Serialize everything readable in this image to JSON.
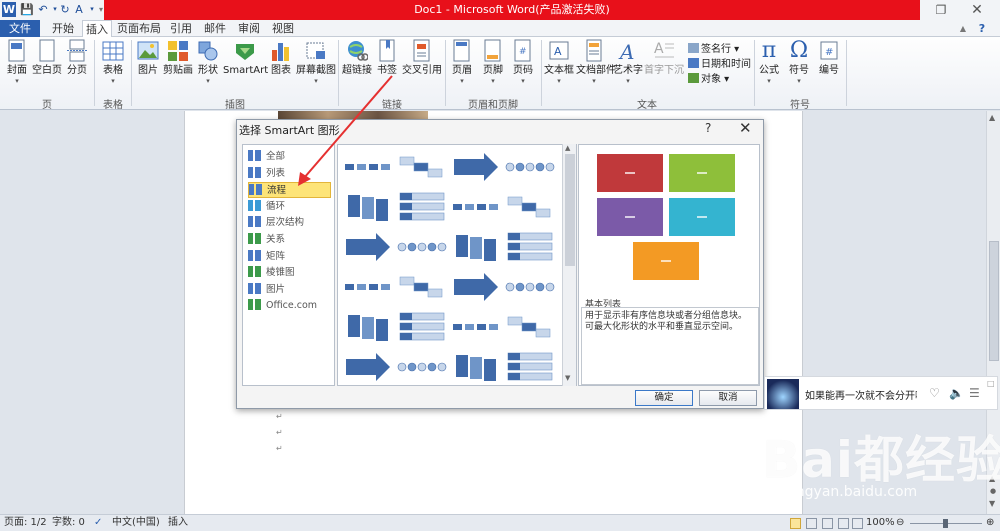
{
  "window": {
    "title": "Doc1 - Microsoft Word(产品激活失败)",
    "logo_letter": "W"
  },
  "tabs": [
    "文件",
    "开始",
    "插入",
    "页面布局",
    "引用",
    "邮件",
    "审阅",
    "视图"
  ],
  "ribbon": {
    "groups": {
      "pages": "页",
      "tables": "表格",
      "illustrations": "插图",
      "links": "链接",
      "header_footer": "页眉和页脚",
      "text": "文本",
      "symbols": "符号"
    },
    "buttons": {
      "cover": "封面",
      "blank_page": "空白页",
      "page_break": "分页",
      "table": "表格",
      "picture": "图片",
      "clipart": "剪贴画",
      "shapes": "形状",
      "smartart": "SmartArt",
      "chart": "图表",
      "screenshot": "屏幕截图",
      "hyperlink": "超链接",
      "bookmark": "书签",
      "cross_ref": "交叉引用",
      "header": "页眉",
      "footer": "页脚",
      "page_number": "页码",
      "textbox": "文本框",
      "quick_parts": "文档部件",
      "wordart": "艺术字",
      "dropcap": "首字下沉",
      "signature": "签名行",
      "datetime": "日期和时间",
      "object": "对象",
      "equation": "公式",
      "symbol": "符号",
      "number": "编号"
    }
  },
  "dialog": {
    "title": "选择 SmartArt 图形",
    "help": "?",
    "categories": [
      "全部",
      "列表",
      "流程",
      "循环",
      "层次结构",
      "关系",
      "矩阵",
      "棱锥图",
      "图片",
      "Office.com"
    ],
    "selected_category": "流程",
    "preview_name": "基本列表",
    "preview_desc": "用于显示非有序信息块或者分组信息块。可最大化形状的水平和垂直显示空间。",
    "ok": "确定",
    "cancel": "取消"
  },
  "statusbar": {
    "page": "页面: 1/2",
    "words": "字数: 0",
    "language": "中文(中国)",
    "mode": "插入",
    "zoom": "100%"
  },
  "notification": {
    "text": "如果能再一次就不会分开嘛"
  },
  "watermark": {
    "logo": "Bai都经验",
    "url": "jingyan.baidu.com"
  },
  "colors": {
    "title_bar": "#e8101a",
    "file_tab": "#2b5fae",
    "selected_category": "#fde478",
    "preview_red": "#c0393b",
    "preview_green": "#8ebf3a",
    "preview_purple": "#7b5aa8",
    "preview_cyan": "#34b4d0",
    "preview_orange": "#f39a24",
    "arrow": "#e53030"
  }
}
